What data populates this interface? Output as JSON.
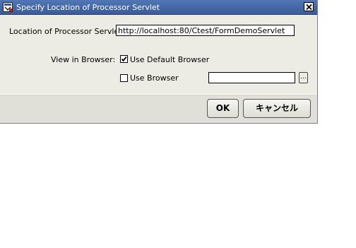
{
  "window": {
    "title": "Specify Location of Processor Servlet"
  },
  "form": {
    "servlet_label": "Location of Processor Servlet:",
    "servlet_value": "http://localhost:80/Ctest/FormDemoServlet",
    "view_label": "View in  Browser:",
    "default_browser_label": "Use Default Browser",
    "default_browser_checked": true,
    "use_browser_label": "Use Browser",
    "use_browser_checked": false,
    "browser_path_value": "",
    "browse_label": "..."
  },
  "buttons": {
    "ok_label": "OK",
    "cancel_label": "キャンセル"
  },
  "colors": {
    "titlebar": "#3b5b98",
    "dialog_bg": "#ecebe4"
  }
}
